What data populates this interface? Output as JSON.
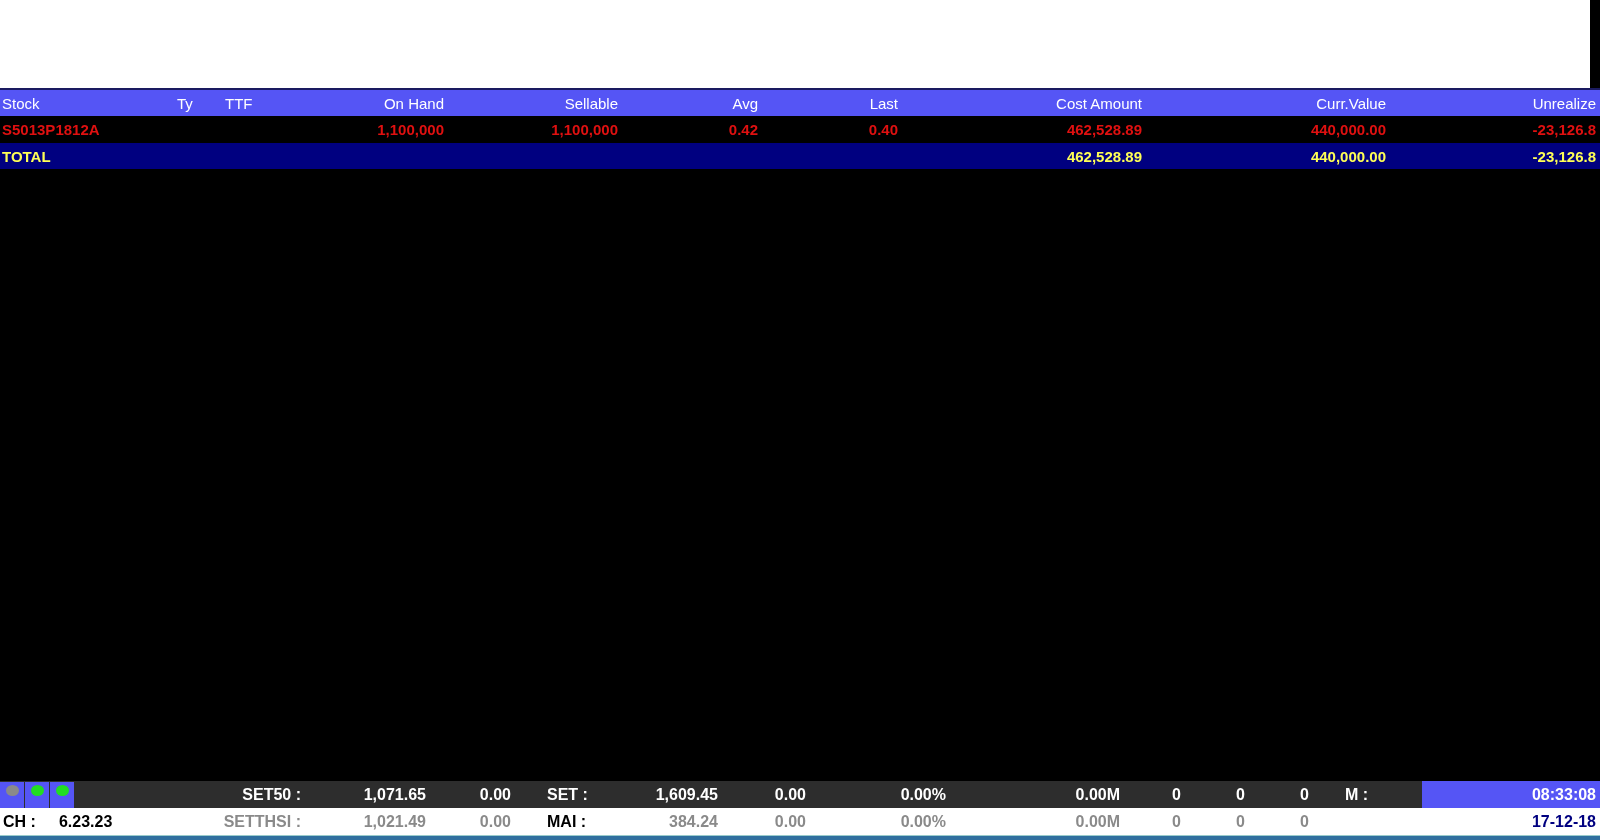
{
  "table": {
    "columns": [
      "Stock",
      "Ty",
      "TTF",
      "On Hand",
      "Sellable",
      "Avg",
      "Last",
      "Cost Amount",
      "Curr.Value",
      "Unrealize"
    ],
    "rows": [
      {
        "kind": "position",
        "stock": "S5013P1812A",
        "on_hand": "1,100,000",
        "sellable": "1,100,000",
        "avg": "0.42",
        "last": "0.40",
        "cost_amount": "462,528.89",
        "curr_value": "440,000.00",
        "unrealize": "-23,126.8"
      },
      {
        "kind": "total",
        "stock": "TOTAL",
        "cost_amount": "462,528.89",
        "curr_value": "440,000.00",
        "unrealize": "-23,126.8"
      }
    ]
  },
  "market_bar": {
    "indicators": [
      {
        "color": "#8a8a8a"
      },
      {
        "color": "#22dd22"
      },
      {
        "color": "#22dd22"
      }
    ],
    "cells": [
      {
        "kind": "label",
        "text": "SET50 :"
      },
      {
        "kind": "value",
        "text": "1,071.65"
      },
      {
        "kind": "value",
        "text": "0.00"
      },
      {
        "kind": "label",
        "text": "SET :"
      },
      {
        "kind": "value",
        "text": "1,609.45"
      },
      {
        "kind": "value",
        "text": "0.00"
      },
      {
        "kind": "value",
        "text": "0.00%"
      },
      {
        "kind": "value",
        "text": "0.00M"
      },
      {
        "kind": "value",
        "text": "0"
      },
      {
        "kind": "value",
        "text": "0"
      },
      {
        "kind": "value",
        "text": "0"
      },
      {
        "kind": "label",
        "text": "M :"
      },
      {
        "kind": "clock",
        "text": "08:33:08"
      }
    ]
  },
  "info_bar": {
    "lead": [
      {
        "text": "CH :"
      },
      {
        "text": "6.23.23"
      }
    ],
    "cells": [
      {
        "kind": "dimlabel",
        "text": "SETTHSI :"
      },
      {
        "kind": "dimvalue",
        "text": "1,021.49"
      },
      {
        "kind": "dimvalue",
        "text": "0.00"
      },
      {
        "kind": "label",
        "text": "MAI :"
      },
      {
        "kind": "dimvalue",
        "text": "384.24"
      },
      {
        "kind": "dimvalue",
        "text": "0.00"
      },
      {
        "kind": "dimvalue",
        "text": "0.00%"
      },
      {
        "kind": "dimvalue",
        "text": "0.00M"
      },
      {
        "kind": "dimvalue",
        "text": "0"
      },
      {
        "kind": "dimvalue",
        "text": "0"
      },
      {
        "kind": "dimvalue",
        "text": "0"
      },
      {
        "kind": "date",
        "text": "17-12-18"
      }
    ]
  }
}
